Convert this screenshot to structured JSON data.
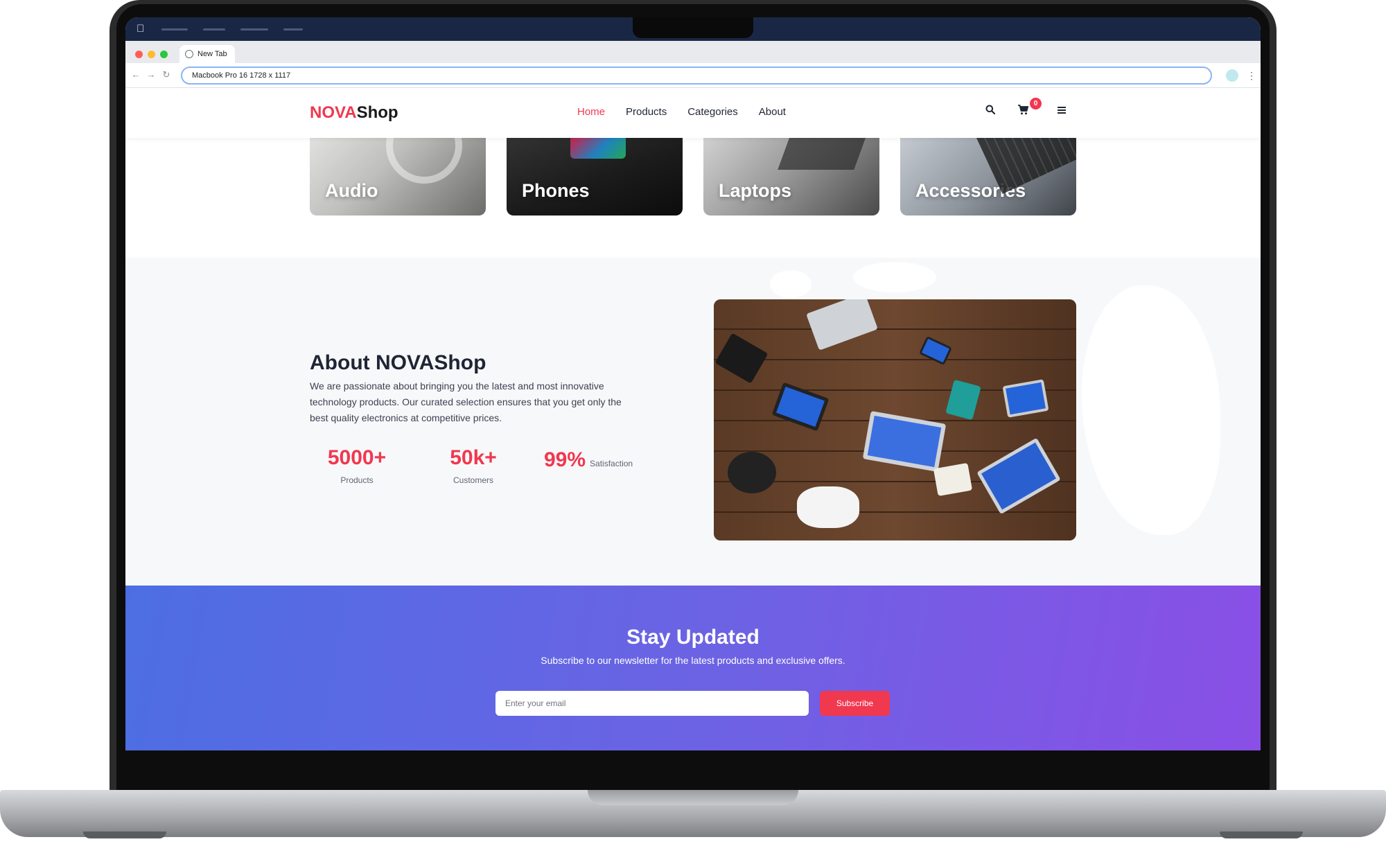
{
  "browser": {
    "tab_title": "New Tab",
    "url": "Macbook Pro 16   1728 x 1117"
  },
  "site": {
    "logo_accent": "NOVA",
    "logo_rest": "Shop",
    "nav": [
      {
        "label": "Home",
        "active": true
      },
      {
        "label": "Products",
        "active": false
      },
      {
        "label": "Categories",
        "active": false
      },
      {
        "label": "About",
        "active": false
      }
    ],
    "cart_count": "0",
    "icons": {
      "search": "search-icon",
      "cart": "cart-icon",
      "menu": "hamburger-menu-icon"
    }
  },
  "categories": [
    {
      "label": "Audio"
    },
    {
      "label": "Phones"
    },
    {
      "label": "Laptops"
    },
    {
      "label": "Accessories"
    }
  ],
  "about": {
    "title": "About NOVAShop",
    "text": "We are passionate about bringing you the latest and most innovative technology products. Our curated selection ensures that you get only the best quality electronics at competitive prices.",
    "stats": [
      {
        "value": "5000+",
        "label": "Products"
      },
      {
        "value": "50k+",
        "label": "Customers"
      },
      {
        "value": "99%",
        "label": "Satisfaction"
      }
    ]
  },
  "newsletter": {
    "title": "Stay Updated",
    "subtitle": "Subscribe to our newsletter for the latest products and exclusive offers.",
    "email_placeholder": "Enter your email",
    "button_label": "Subscribe"
  },
  "colors": {
    "accent": "#f0384f",
    "menubar": "#1a2744",
    "newsletter_start": "#4d6ee3",
    "newsletter_end": "#8a4fe6"
  }
}
